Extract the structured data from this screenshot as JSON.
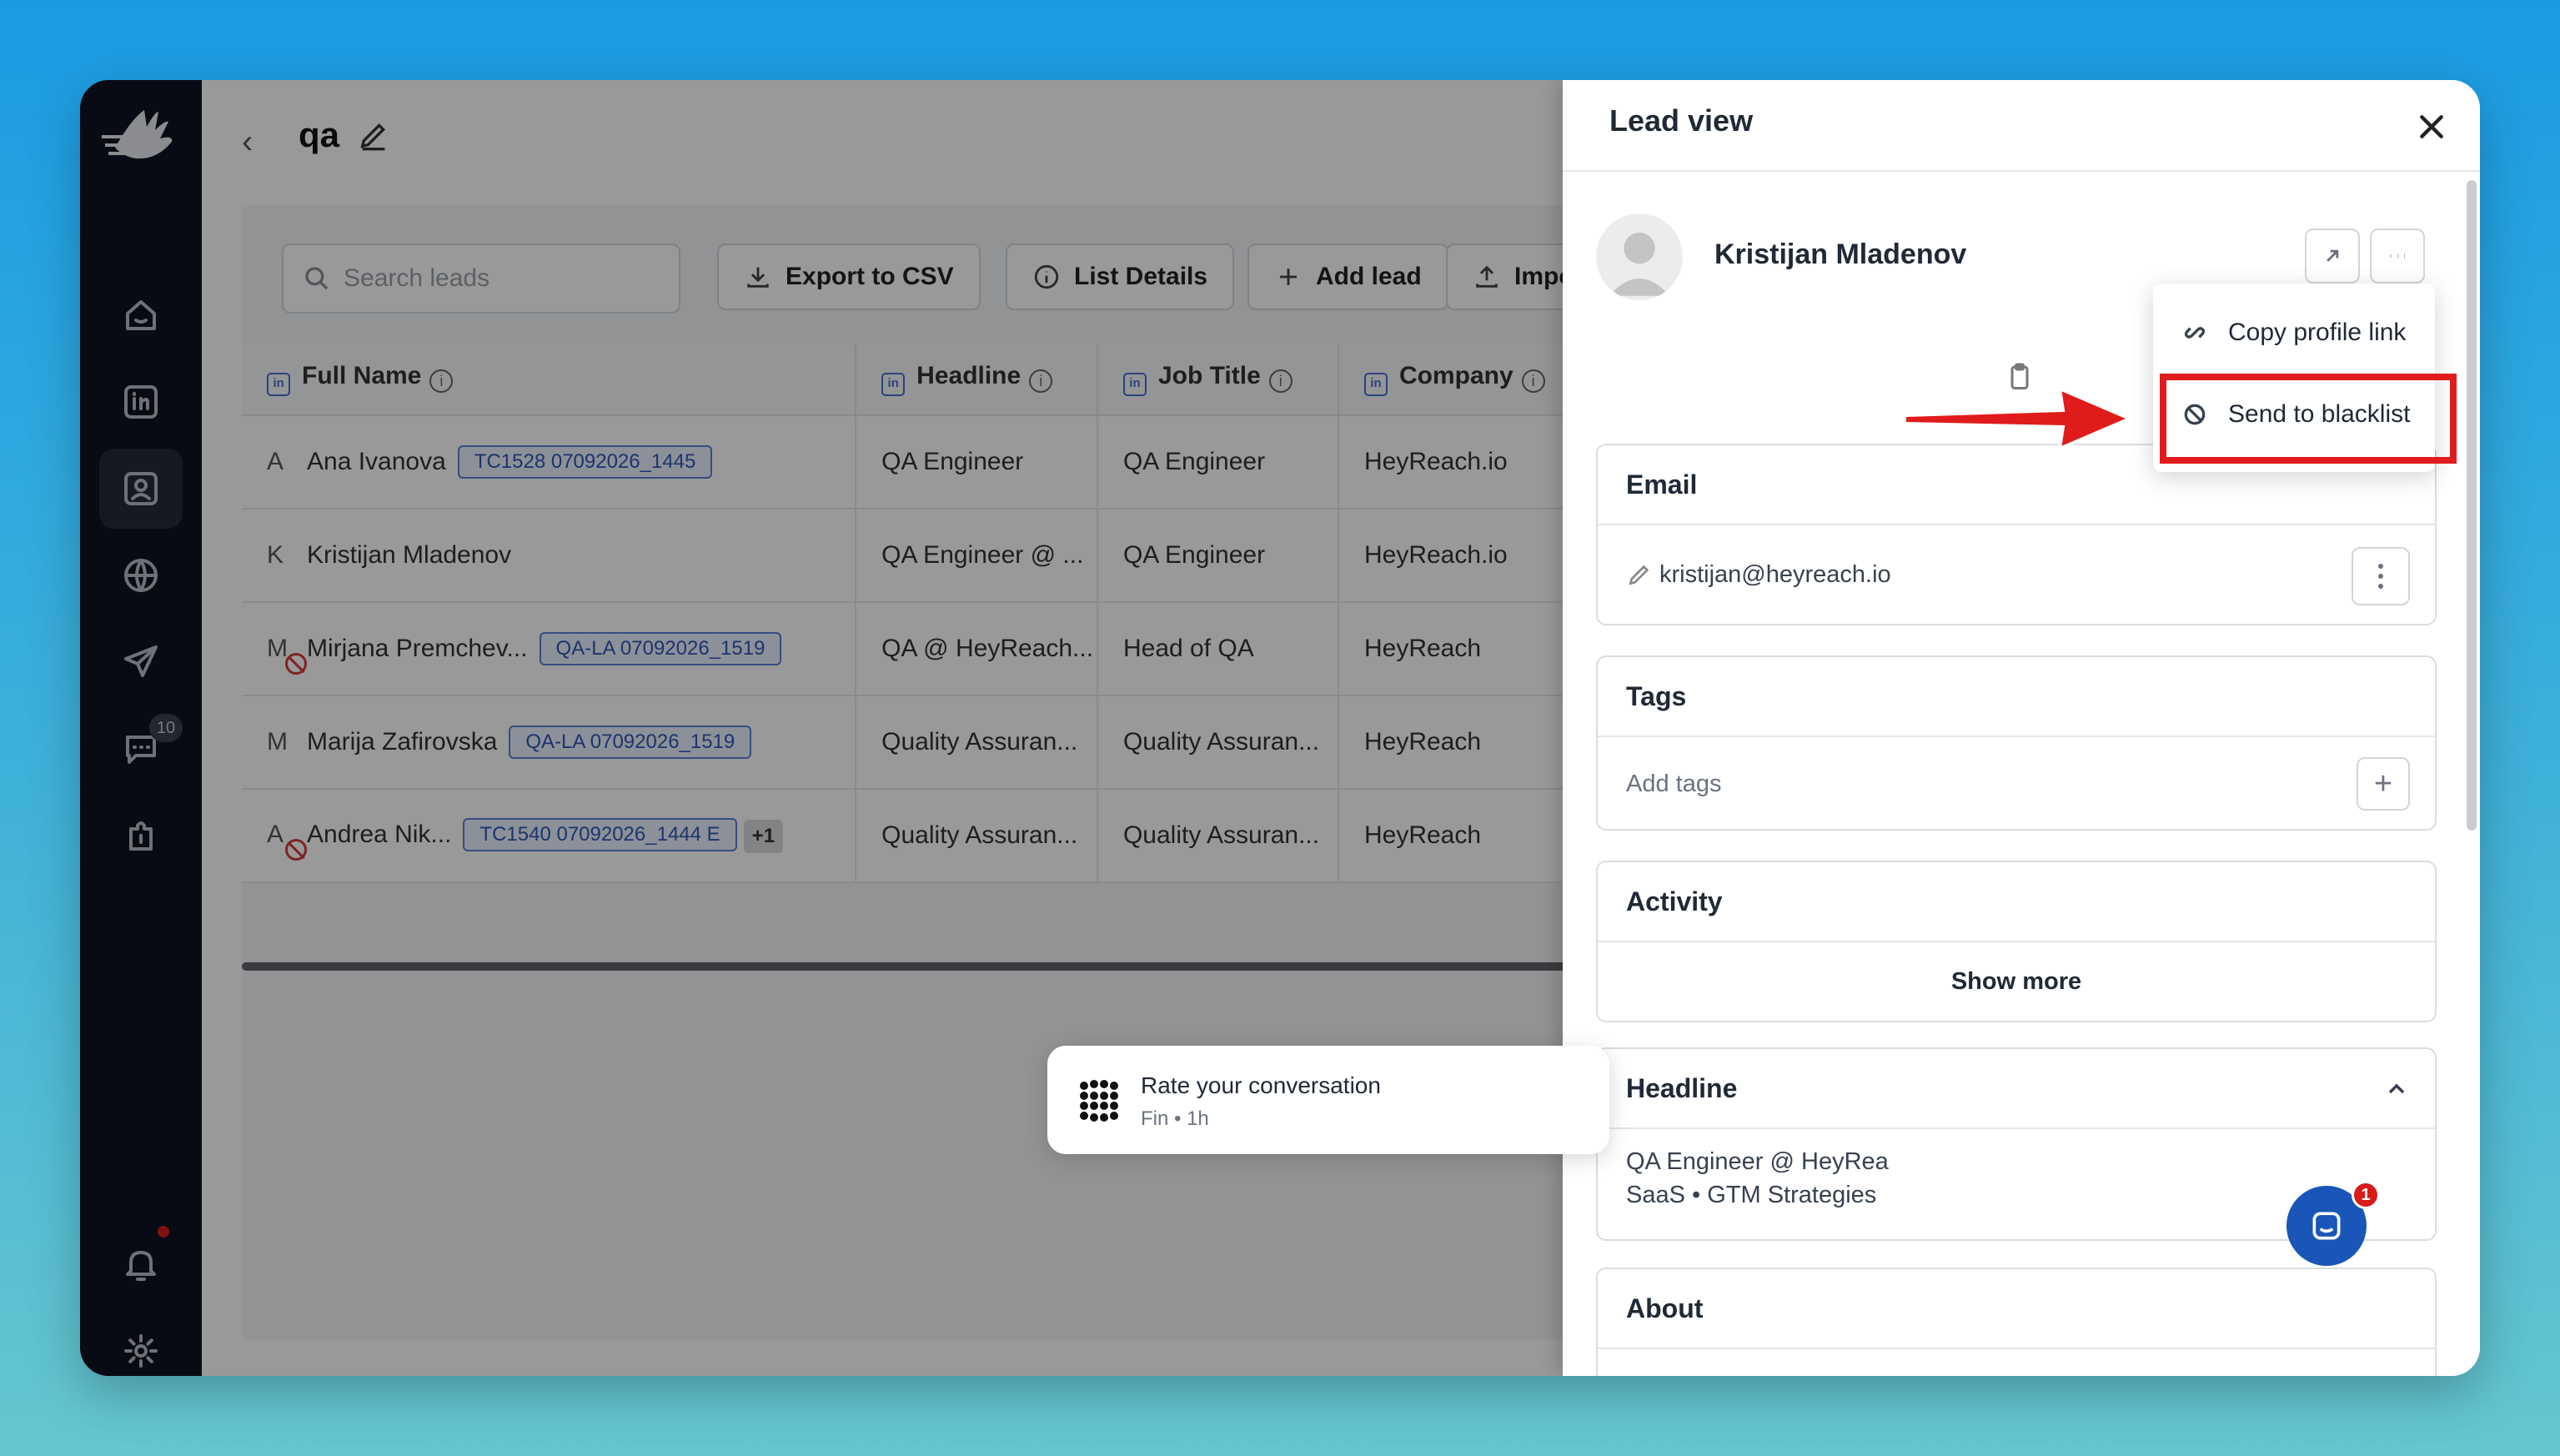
{
  "page": {
    "title": "qa"
  },
  "sidebar": {
    "messages_badge": "10"
  },
  "toolbar": {
    "search_placeholder": "Search leads",
    "export_label": "Export to CSV",
    "details_label": "List Details",
    "add_label": "Add lead",
    "import_label": "Impo"
  },
  "table": {
    "columns": [
      "Full Name",
      "Headline",
      "Job Title",
      "Company"
    ],
    "rows": [
      {
        "initial": "A",
        "name": "Ana Ivanova",
        "tag": "TC1528 07092026_1445",
        "extra": "",
        "headline": "QA Engineer",
        "job": "QA Engineer",
        "company": "HeyReach.io"
      },
      {
        "initial": "K",
        "name": "Kristijan Mladenov",
        "tag": "",
        "extra": "",
        "headline": "QA Engineer @ ...",
        "job": "QA Engineer",
        "company": "HeyReach.io"
      },
      {
        "initial": "M",
        "name": "Mirjana Premchev...",
        "tag": "QA-LA 07092026_1519",
        "extra": "",
        "headline": "QA @ HeyReach...",
        "job": "Head of QA",
        "company": "HeyReach"
      },
      {
        "initial": "M",
        "name": "Marija Zafirovska",
        "tag": "QA-LA 07092026_1519",
        "extra": "",
        "headline": "Quality Assuran...",
        "job": "Quality Assuran...",
        "company": "HeyReach"
      },
      {
        "initial": "A",
        "name": "Andrea Nik...",
        "tag": "TC1540 07092026_1444 E",
        "extra": "+1",
        "headline": "Quality Assuran...",
        "job": "Quality Assuran...",
        "company": "HeyReach"
      }
    ]
  },
  "panel": {
    "title": "Lead view",
    "lead_name": "Kristijan Mladenov",
    "menu": {
      "copy": "Copy profile link",
      "blacklist": "Send to blacklist"
    },
    "email": {
      "title": "Email",
      "value": "kristijan@heyreach.io"
    },
    "tags": {
      "title": "Tags",
      "placeholder": "Add tags"
    },
    "activity": {
      "title": "Activity",
      "show_more": "Show more"
    },
    "headline": {
      "title": "Headline",
      "line1": "QA Engineer @ HeyRea",
      "line2": "SaaS • GTM Strategies"
    },
    "about": {
      "title": "About"
    }
  },
  "fin": {
    "title": "Rate your conversation",
    "sub": "Fin • 1h"
  },
  "chat": {
    "badge": "1"
  },
  "colors": {
    "sidebar": "#101322",
    "highlight": "#e01b1b",
    "chat": "#1a56b8",
    "tag": "#2f57b7"
  }
}
